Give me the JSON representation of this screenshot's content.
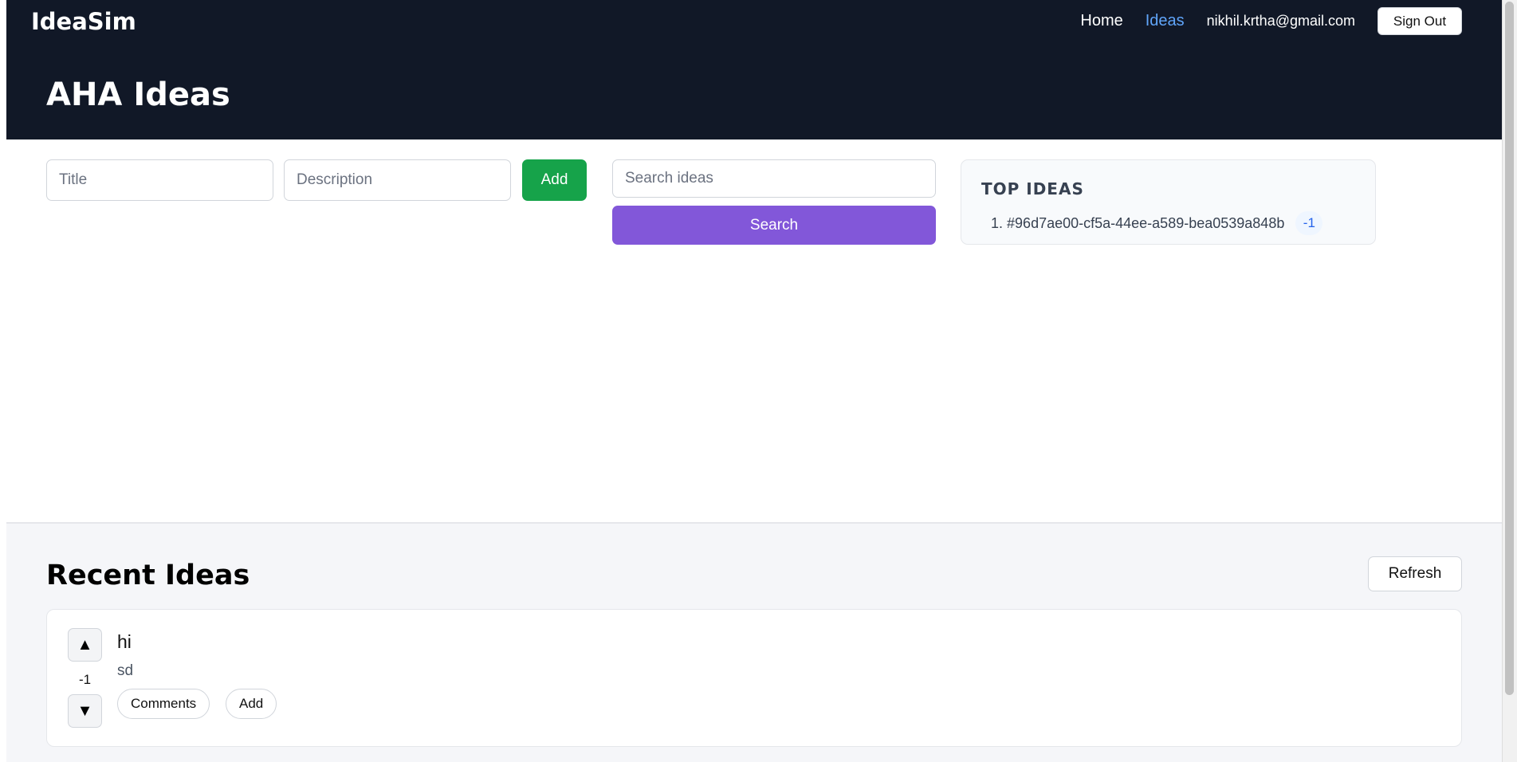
{
  "nav": {
    "logo": "IdeaSim",
    "home": "Home",
    "ideas": "Ideas",
    "email": "nikhil.krtha@gmail.com",
    "signout": "Sign Out"
  },
  "page_title": "AHA Ideas",
  "form": {
    "title_placeholder": "Title",
    "description_placeholder": "Description",
    "add_label": "Add"
  },
  "search": {
    "placeholder": "Search ideas",
    "button": "Search"
  },
  "top_ideas": {
    "heading": "TOP IDEAS",
    "items": [
      {
        "rank": "1.",
        "id": "#96d7ae00-cf5a-44ee-a589-bea0539a848b",
        "score": "-1"
      }
    ]
  },
  "recent": {
    "heading": "Recent Ideas",
    "refresh": "Refresh",
    "ideas": [
      {
        "up": "▲",
        "down": "▼",
        "score": "-1",
        "title": "hi",
        "description": "sd",
        "comments": "Comments",
        "add": "Add"
      }
    ]
  },
  "colors": {
    "header": "#111827",
    "add": "#16a34a",
    "search": "#8257d9",
    "active_link": "#60a5fa"
  }
}
